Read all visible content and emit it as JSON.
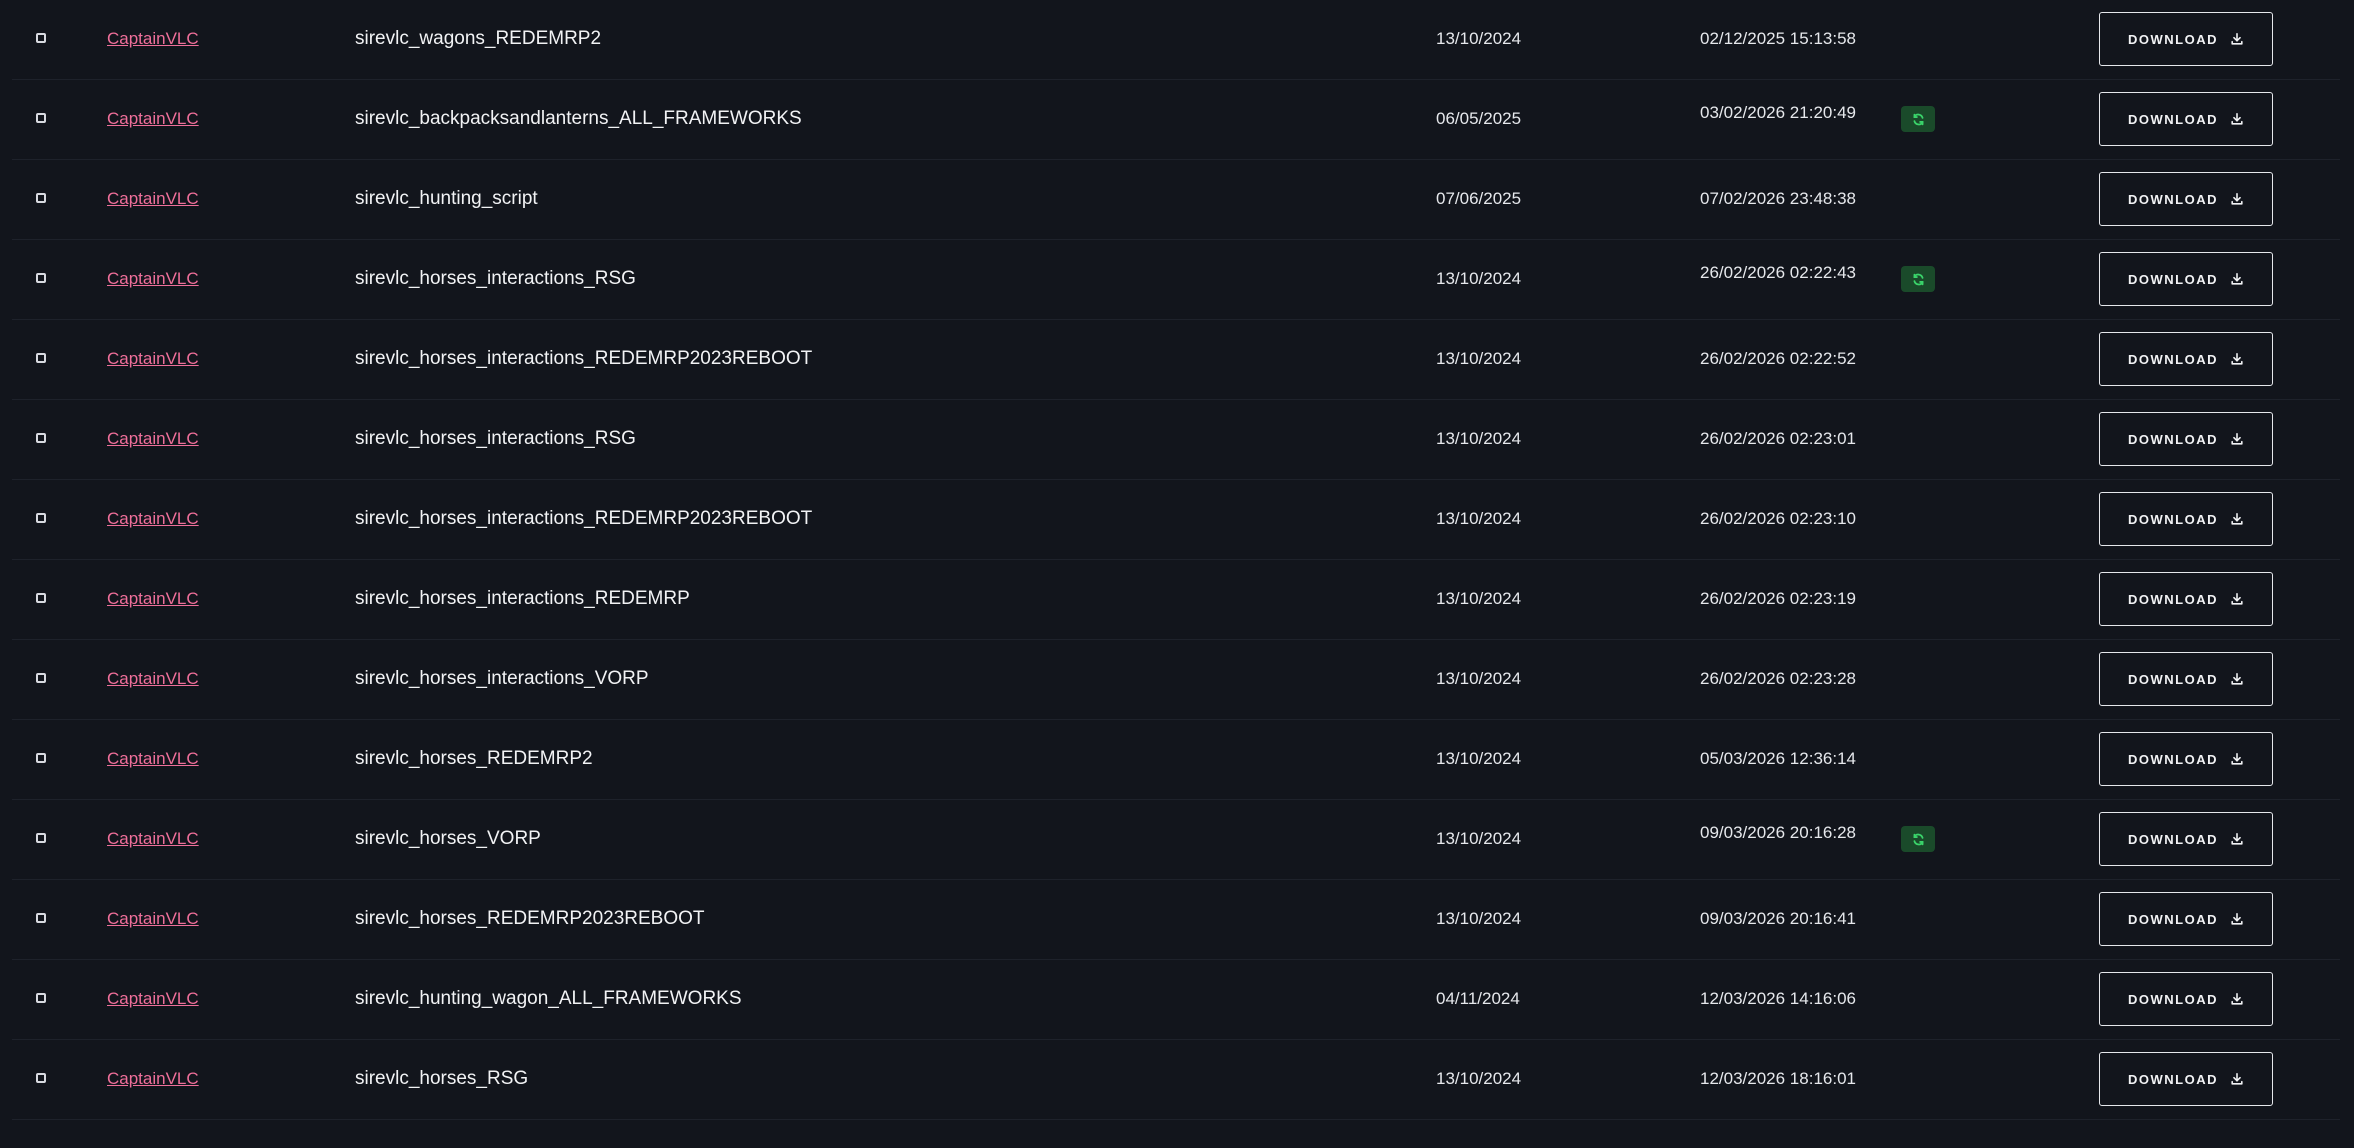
{
  "colors": {
    "background": "#12151c",
    "author_link": "#ef6f9a",
    "sync_badge_bg": "#1a4a2a",
    "sync_badge_icon": "#3ad46a"
  },
  "icons": {
    "checkbox": "checkbox-icon",
    "sync": "refresh-icon",
    "download": "download-icon"
  },
  "download_label": "DOWNLOAD",
  "rows": [
    {
      "author": "CaptainVLC",
      "name": "sirevlc_wagons_REDEMRP2",
      "created": "13/10/2024",
      "updated": "02/12/2025 15:13:58",
      "sync": false
    },
    {
      "author": "CaptainVLC",
      "name": "sirevlc_backpacksandlanterns_ALL_FRAMEWORKS",
      "created": "06/05/2025",
      "updated": "03/02/2026 21:20:49",
      "sync": true
    },
    {
      "author": "CaptainVLC",
      "name": "sirevlc_hunting_script",
      "created": "07/06/2025",
      "updated": "07/02/2026 23:48:38",
      "sync": false
    },
    {
      "author": "CaptainVLC",
      "name": "sirevlc_horses_interactions_RSG",
      "created": "13/10/2024",
      "updated": "26/02/2026 02:22:43",
      "sync": true
    },
    {
      "author": "CaptainVLC",
      "name": "sirevlc_horses_interactions_REDEMRP2023REBOOT",
      "created": "13/10/2024",
      "updated": "26/02/2026 02:22:52",
      "sync": false
    },
    {
      "author": "CaptainVLC",
      "name": "sirevlc_horses_interactions_RSG",
      "created": "13/10/2024",
      "updated": "26/02/2026 02:23:01",
      "sync": false
    },
    {
      "author": "CaptainVLC",
      "name": "sirevlc_horses_interactions_REDEMRP2023REBOOT",
      "created": "13/10/2024",
      "updated": "26/02/2026 02:23:10",
      "sync": false
    },
    {
      "author": "CaptainVLC",
      "name": "sirevlc_horses_interactions_REDEMRP",
      "created": "13/10/2024",
      "updated": "26/02/2026 02:23:19",
      "sync": false
    },
    {
      "author": "CaptainVLC",
      "name": "sirevlc_horses_interactions_VORP",
      "created": "13/10/2024",
      "updated": "26/02/2026 02:23:28",
      "sync": false
    },
    {
      "author": "CaptainVLC",
      "name": "sirevlc_horses_REDEMRP2",
      "created": "13/10/2024",
      "updated": "05/03/2026 12:36:14",
      "sync": false
    },
    {
      "author": "CaptainVLC",
      "name": "sirevlc_horses_VORP",
      "created": "13/10/2024",
      "updated": "09/03/2026 20:16:28",
      "sync": true
    },
    {
      "author": "CaptainVLC",
      "name": "sirevlc_horses_REDEMRP2023REBOOT",
      "created": "13/10/2024",
      "updated": "09/03/2026 20:16:41",
      "sync": false
    },
    {
      "author": "CaptainVLC",
      "name": "sirevlc_hunting_wagon_ALL_FRAMEWORKS",
      "created": "04/11/2024",
      "updated": "12/03/2026 14:16:06",
      "sync": false
    },
    {
      "author": "CaptainVLC",
      "name": "sirevlc_horses_RSG",
      "created": "13/10/2024",
      "updated": "12/03/2026 18:16:01",
      "sync": false
    }
  ]
}
